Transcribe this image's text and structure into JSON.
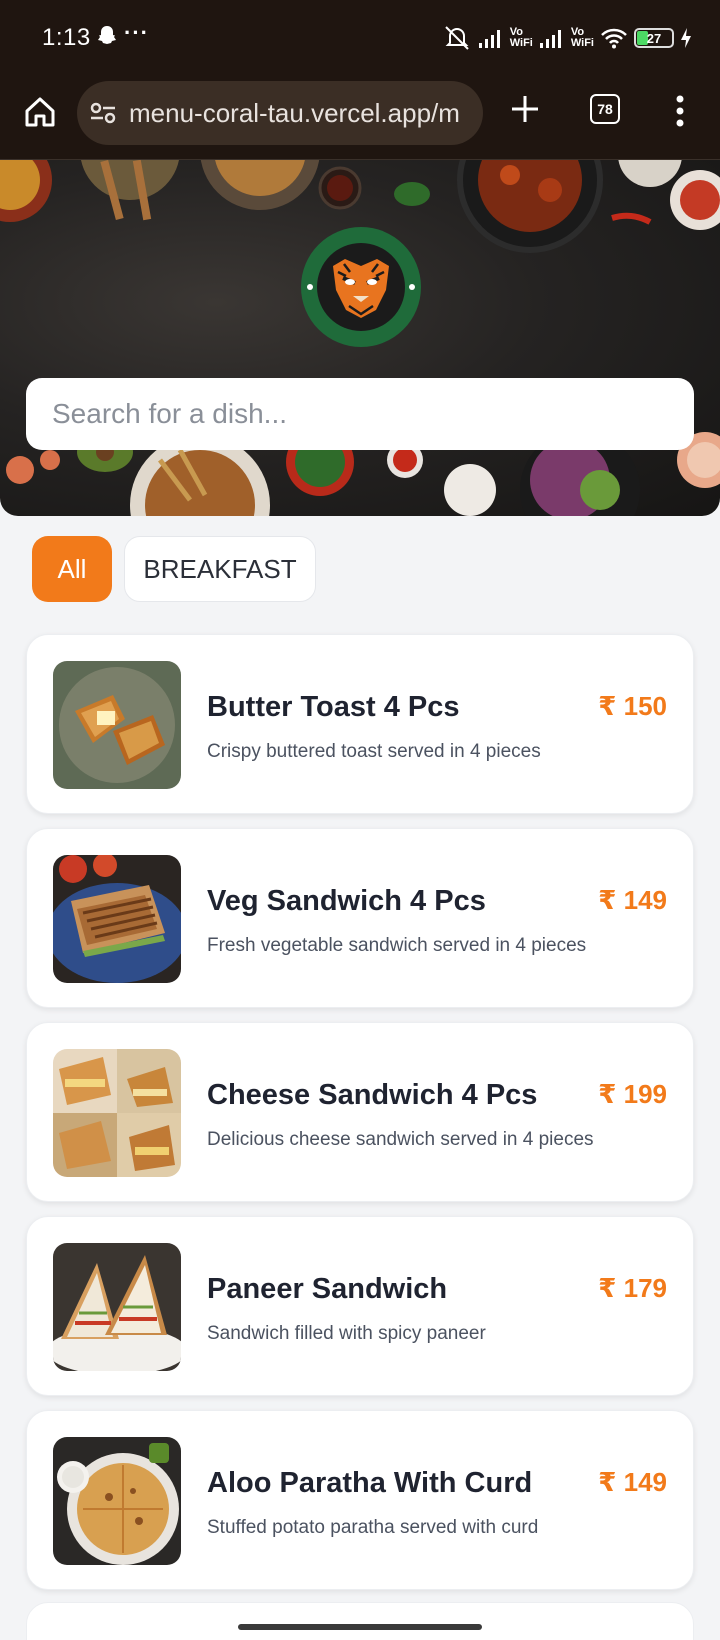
{
  "status_bar": {
    "time": "1:13",
    "dots": "···",
    "vowifi_1": "Vo\nWiFi",
    "vowifi_2": "Vo\nWiFi",
    "battery": "27"
  },
  "browser": {
    "url": "menu-coral-tau.vercel.app/m",
    "tab_count": "78"
  },
  "search": {
    "placeholder": "Search for a dish..."
  },
  "categories": [
    {
      "label": "All",
      "active": true
    },
    {
      "label": "BREAKFAST",
      "active": false
    }
  ],
  "menu_items": [
    {
      "name": "Butter Toast 4 Pcs",
      "price": "₹ 150",
      "description": "Crispy buttered toast served in 4 pieces"
    },
    {
      "name": "Veg Sandwich 4 Pcs",
      "price": "₹ 149",
      "description": "Fresh vegetable sandwich served in 4 pieces"
    },
    {
      "name": "Cheese Sandwich 4 Pcs",
      "price": "₹ 199",
      "description": "Delicious cheese sandwich served in 4 pieces"
    },
    {
      "name": "Paneer Sandwich",
      "price": "₹ 179",
      "description": "Sandwich filled with spicy paneer"
    },
    {
      "name": "Aloo Paratha With Curd",
      "price": "₹ 149",
      "description": "Stuffed potato paratha served with curd"
    }
  ],
  "colors": {
    "accent": "#f27a1a",
    "browser_bg": "#1f1510",
    "page_bg": "#f3f4f6"
  }
}
